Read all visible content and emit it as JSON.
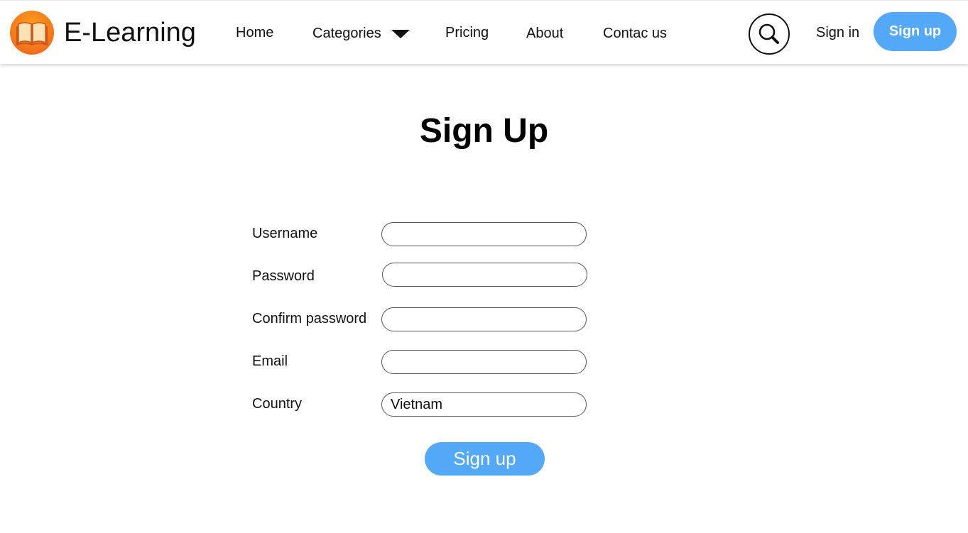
{
  "brand": {
    "name": "E-Learning",
    "logo_icon": "open-book-icon",
    "logo_colors": {
      "outer": "#f26b1d",
      "inner": "#f9a11b",
      "pages": "#fde3b3"
    }
  },
  "nav": {
    "home": "Home",
    "categories": "Categories",
    "pricing": "Pricing",
    "about": "About",
    "contact": "Contac us"
  },
  "header_actions": {
    "search_icon": "search-icon",
    "sign_in": "Sign in",
    "sign_up": "Sign up"
  },
  "form": {
    "title": "Sign Up",
    "fields": {
      "username": {
        "label": "Username",
        "value": ""
      },
      "password": {
        "label": "Password",
        "value": ""
      },
      "confirm_password": {
        "label": "Confirm password",
        "value": ""
      },
      "email": {
        "label": "Email",
        "value": ""
      },
      "country": {
        "label": "Country",
        "value": "Vietnam"
      }
    },
    "submit": "Sign up"
  },
  "colors": {
    "accent": "#54a8f8",
    "text": "#111111"
  }
}
